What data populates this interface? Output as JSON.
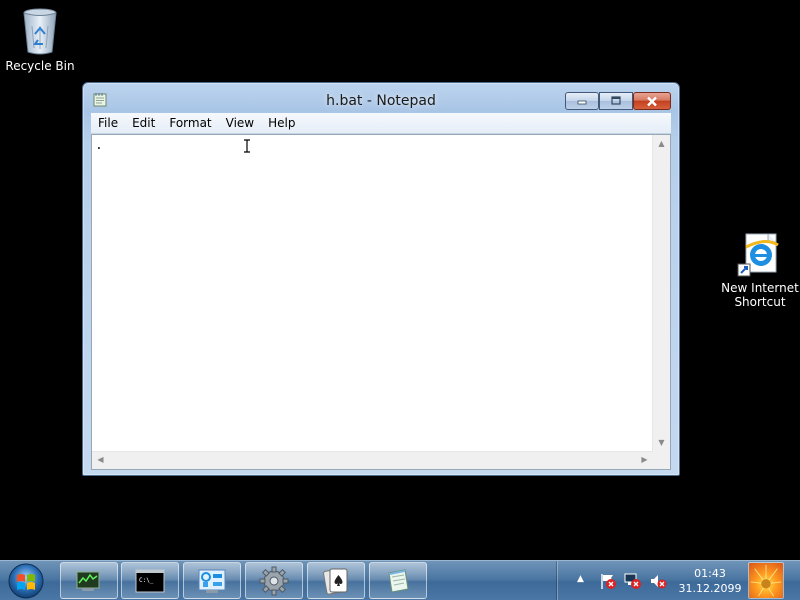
{
  "desktop": {
    "icons": [
      {
        "label": "Recycle Bin",
        "icon": "recycle-bin-icon"
      },
      {
        "label": "New Internet Shortcut",
        "icon": "internet-explorer-icon"
      }
    ]
  },
  "notepad": {
    "title": "h.bat - Notepad",
    "icon": "notepad-icon",
    "menu": [
      "File",
      "Edit",
      "Format",
      "View",
      "Help"
    ],
    "content": ".",
    "caption_buttons": [
      "minimize-icon",
      "maximize-icon",
      "close-icon"
    ]
  },
  "taskbar": {
    "start_icon": "windows-start-icon",
    "tasks": [
      {
        "icon": "system-monitor-icon"
      },
      {
        "icon": "command-prompt-icon",
        "text": "C:\\_"
      },
      {
        "icon": "control-panel-icon"
      },
      {
        "icon": "gear-icon"
      },
      {
        "icon": "solitaire-icon"
      },
      {
        "icon": "notepad-icon"
      }
    ],
    "tray": {
      "icons": [
        "show-hidden-icons-icon",
        "action-center-flag-icon",
        "network-icon",
        "volume-muted-icon"
      ],
      "time": "01:43",
      "date": "31.12.2099"
    }
  },
  "colors": {
    "desktop_bg": "#000000",
    "taskbar": "#4c77a3",
    "window_frame": "#a9c5e6",
    "close_button": "#c4401f"
  }
}
